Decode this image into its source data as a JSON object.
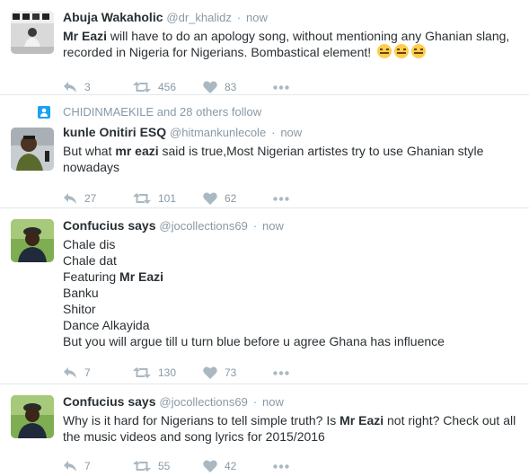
{
  "tweets": [
    {
      "fullname": "Abuja Wakaholic",
      "username": "@dr_khalidz",
      "dot": "·",
      "time": "now",
      "body": {
        "b1": "Mr Eazi",
        "t1": " will have to do an apology song, without mentioning any Ghanian slang, recorded in Nigeria for Nigerians. Bombastical element! "
      },
      "emoji": [
        "expressionless-face-emoji",
        "expressionless-face-emoji",
        "expressionless-face-emoji"
      ],
      "replies": "3",
      "retweets": "456",
      "likes": "83"
    },
    {
      "context": "CHIDINMAEKILE and 28 others follow",
      "fullname": "kunle Onitiri ESQ",
      "username": "@hitmankunlecole",
      "dot": "·",
      "time": "now",
      "body": {
        "t0": "But what ",
        "b1": "mr eazi",
        "t1": " said is true,Most Nigerian artistes try to use Ghanian style nowadays"
      },
      "replies": "27",
      "retweets": "101",
      "likes": "62"
    },
    {
      "fullname": "Confucius says",
      "username": "@jocollections69",
      "dot": "·",
      "time": "now",
      "lines": {
        "l1": "Chale dis",
        "l2": "Chale dat",
        "l3a": "Featuring ",
        "l3b": "Mr Eazi",
        "l4": "Banku",
        "l5": "Shitor",
        "l6": "Dance Alkayida",
        "l7": "But you will argue till u turn blue before u agree Ghana has influence"
      },
      "replies": "7",
      "retweets": "130",
      "likes": "73"
    },
    {
      "fullname": "Confucius says",
      "username": "@jocollections69",
      "dot": "·",
      "time": "now",
      "body": {
        "t0": "Why is it hard for Nigerians to tell simple truth? Is ",
        "b1": "Mr Eazi",
        "t1": " not right? Check out all the music videos and song lyrics for 2015/2016"
      },
      "replies": "7",
      "retweets": "55",
      "likes": "42"
    }
  ]
}
